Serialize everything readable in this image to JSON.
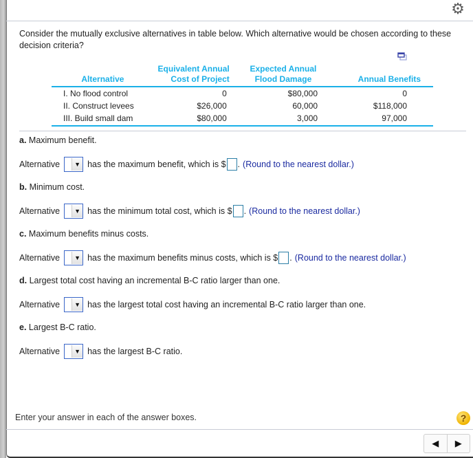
{
  "question": {
    "text": "Consider the mutually exclusive alternatives in table below. Which alternative would be chosen according to these decision criteria?"
  },
  "table": {
    "headers": [
      {
        "line1": "",
        "line2": "Alternative"
      },
      {
        "line1": "Equivalent Annual",
        "line2": "Cost of Project"
      },
      {
        "line1": "Expected Annual",
        "line2": "Flood Damage"
      },
      {
        "line1": "",
        "line2": "Annual Benefits"
      }
    ],
    "rows": [
      [
        "I. No flood control",
        "0",
        "$80,000",
        "0"
      ],
      [
        "II. Construct levees",
        "$26,000",
        "60,000",
        "$118,000"
      ],
      [
        "III. Build small dam",
        "$80,000",
        "3,000",
        "97,000"
      ]
    ],
    "accent_color": "#1ab0e8"
  },
  "parts": [
    {
      "letter": "a.",
      "title": " Maximum benefit.",
      "prefix": "Alternative",
      "dropdown_value": "",
      "text": "has the maximum benefit, which is $",
      "answer_value": "",
      "suffix": ".",
      "hint": "(Round to the nearest dollar.)"
    },
    {
      "letter": "b.",
      "title": " Minimum cost.",
      "prefix": "Alternative",
      "dropdown_value": "",
      "text": "has the minimum total cost, which is $",
      "answer_value": "",
      "suffix": ".",
      "hint": "(Round to the nearest dollar.)"
    },
    {
      "letter": "c.",
      "title": " Maximum benefits minus costs.",
      "prefix": "Alternative",
      "dropdown_value": "",
      "text": "has the maximum benefits minus costs, which is $",
      "answer_value": "",
      "suffix": ".",
      "hint": "(Round to the nearest dollar.)"
    },
    {
      "letter": "d.",
      "title": " Largest total cost having an incremental B-C ratio larger than one.",
      "prefix": "Alternative",
      "dropdown_value": "",
      "text": "has the largest total cost having an incremental B-C ratio larger than one."
    },
    {
      "letter": "e.",
      "title": " Largest B-C ratio.",
      "prefix": "Alternative",
      "dropdown_value": "",
      "text": "has the largest B-C ratio."
    }
  ],
  "footer": {
    "instruction": "Enter your answer in each of the answer boxes.",
    "help_glyph": "?",
    "prev_glyph": "◀",
    "next_glyph": "▶"
  },
  "icons": {
    "gear": "⚙",
    "dropdown_arrow": "▼"
  }
}
